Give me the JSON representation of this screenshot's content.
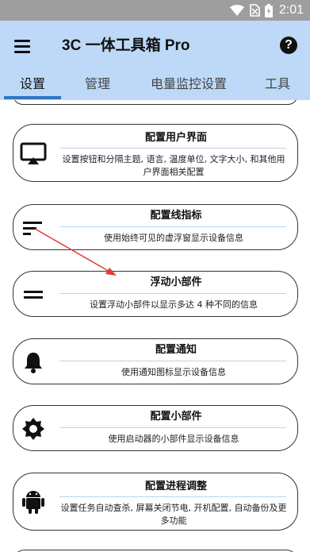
{
  "status_bar": {
    "time": "2:01"
  },
  "app_bar": {
    "title": "3C 一体工具箱 Pro"
  },
  "tabs": [
    {
      "label": "设置",
      "active": true
    },
    {
      "label": "管理",
      "active": false
    },
    {
      "label": "电量监控设置",
      "active": false
    },
    {
      "label": "工具",
      "active": false
    }
  ],
  "cards": [
    {
      "id": "ui",
      "title": "配置用户界面",
      "description": "设置按钮和分隔主题, 语言, 温度单位, 文字大小, 和其他用户界面相关配置",
      "icon": "cast-screen-icon"
    },
    {
      "id": "line",
      "title": "配置线指标",
      "description": "使用始终可见的虚浮窗显示设备信息",
      "icon": "line-indicator-icon"
    },
    {
      "id": "floating",
      "title": "浮动小部件",
      "description": "设置浮动小部件以显示多达 4 种不同的信息",
      "icon": "floating-widget-icon"
    },
    {
      "id": "notify",
      "title": "配置通知",
      "description": "使用通知图标显示设备信息",
      "icon": "bell-icon"
    },
    {
      "id": "widget",
      "title": "配置小部件",
      "description": "使用启动器的小部件显示设备信息",
      "icon": "gear-icon"
    },
    {
      "id": "tweaks",
      "title": "配置进程调整",
      "description": "设置任务自动查杀, 屏幕关闭节电, 开机配置, 自动备份及更多功能",
      "icon": "android-icon"
    }
  ],
  "colors": {
    "app_bar": "#bdd9f7",
    "status_bar": "#9e9e9e",
    "tab_indicator": "#2c76c4",
    "annotation_arrow": "#e53935"
  }
}
